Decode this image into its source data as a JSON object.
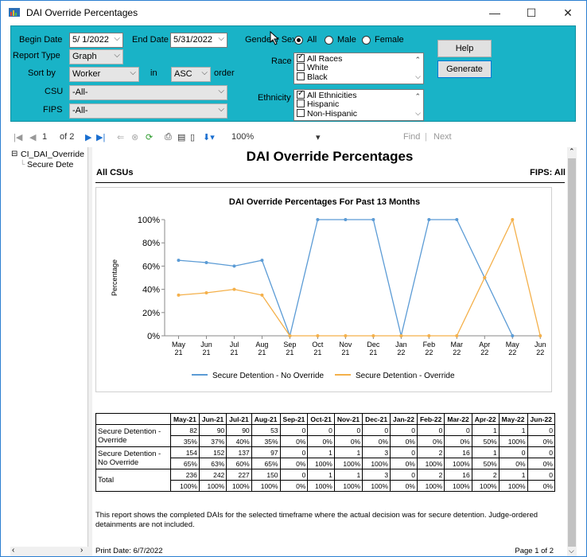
{
  "window": {
    "title": "DAI Override Percentages",
    "minimize": "—",
    "maximize": "☐",
    "close": "✕"
  },
  "params": {
    "begin_date_label": "Begin Date",
    "begin_date_value": "5/ 1/2022",
    "end_date_label": "End Date",
    "end_date_value": "5/31/2022",
    "report_type_label": "Report Type",
    "report_type_value": "Graph",
    "sort_by_label": "Sort by",
    "sort_by_value": "Worker",
    "in_label": "in",
    "order_value": "ASC",
    "order_label": "order",
    "csu_label": "CSU",
    "csu_value": "-All-",
    "fips_label": "FIPS",
    "fips_value": "-All-",
    "gender_label": "Gender",
    "gender_label_rest": "r Sex",
    "gender_options": [
      "All",
      "Male",
      "Female"
    ],
    "gender_selected": "All",
    "race_label": "Race",
    "race_items": [
      "All Races",
      "White",
      "Black"
    ],
    "ethnicity_label": "Ethnicity",
    "ethnicity_items": [
      "All Ethnicities",
      "Hispanic",
      "Non-Hispanic"
    ],
    "help_button": "Help",
    "generate_button": "Generate"
  },
  "toolbar": {
    "page_current": "1",
    "page_of": "of 2",
    "zoom": "100%",
    "find": "Find",
    "separator": "|",
    "next": "Next"
  },
  "tree": {
    "root": "CI_DAI_Override",
    "child": "Secure Dete"
  },
  "report": {
    "title": "DAI Override Percentages",
    "left_header": "All CSUs",
    "right_header": "FIPS: All",
    "note": "This report shows the completed DAIs for the selected timeframe where the actual decision was for secure detention. Judge-ordered detainments are not included.",
    "print_date": "Print Date: 6/7/2022",
    "page_info": "Page 1 of 2"
  },
  "chart_data": {
    "type": "line",
    "title": "DAI Override Percentages For Past 13 Months",
    "xlabel": "",
    "ylabel": "Percentage",
    "ylim": [
      0,
      100
    ],
    "yticks": [
      "0%",
      "20%",
      "40%",
      "60%",
      "80%",
      "100%"
    ],
    "categories": [
      "May 21",
      "Jun 21",
      "Jul 21",
      "Aug 21",
      "Sep 21",
      "Oct 21",
      "Nov 21",
      "Dec 21",
      "Jan 22",
      "Feb 22",
      "Mar 22",
      "Apr 22",
      "May 22",
      "Jun 22"
    ],
    "series": [
      {
        "name": "Secure Detention - No Override",
        "color": "#5b9bd5",
        "values": [
          65,
          63,
          60,
          65,
          0,
          100,
          100,
          100,
          0,
          100,
          100,
          50,
          0,
          null
        ]
      },
      {
        "name": "Secure Detention - Override",
        "color": "#f4b04a",
        "values": [
          35,
          37,
          40,
          35,
          0,
          0,
          0,
          0,
          0,
          0,
          0,
          50,
          100,
          0
        ]
      }
    ],
    "legend": "bottom"
  },
  "table": {
    "headers": [
      "May-21",
      "Jun-21",
      "Jul-21",
      "Aug-21",
      "Sep-21",
      "Oct-21",
      "Nov-21",
      "Dec-21",
      "Jan-22",
      "Feb-22",
      "Mar-22",
      "Apr-22",
      "May-22",
      "Jun-22"
    ],
    "rows": [
      {
        "label": "Secure Detention - Override",
        "counts": [
          "82",
          "90",
          "90",
          "53",
          "0",
          "0",
          "0",
          "0",
          "0",
          "0",
          "0",
          "1",
          "1",
          "0"
        ],
        "pcts": [
          "35%",
          "37%",
          "40%",
          "35%",
          "0%",
          "0%",
          "0%",
          "0%",
          "0%",
          "0%",
          "0%",
          "50%",
          "100%",
          "0%"
        ]
      },
      {
        "label": "Secure Detention - No Override",
        "counts": [
          "154",
          "152",
          "137",
          "97",
          "0",
          "1",
          "1",
          "3",
          "0",
          "2",
          "16",
          "1",
          "0",
          "0"
        ],
        "pcts": [
          "65%",
          "63%",
          "60%",
          "65%",
          "0%",
          "100%",
          "100%",
          "100%",
          "0%",
          "100%",
          "100%",
          "50%",
          "0%",
          "0%"
        ]
      },
      {
        "label": "Total",
        "counts": [
          "236",
          "242",
          "227",
          "150",
          "0",
          "1",
          "1",
          "3",
          "0",
          "2",
          "16",
          "2",
          "1",
          "0"
        ],
        "pcts": [
          "100%",
          "100%",
          "100%",
          "100%",
          "0%",
          "100%",
          "100%",
          "100%",
          "0%",
          "100%",
          "100%",
          "100%",
          "100%",
          "0%"
        ]
      }
    ]
  }
}
